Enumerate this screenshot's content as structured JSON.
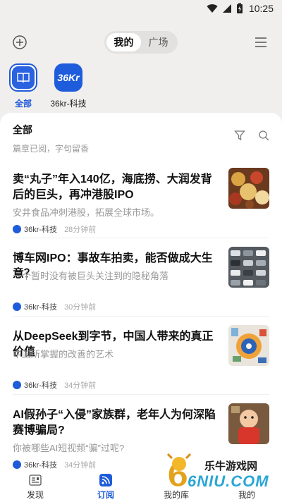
{
  "status_bar": {
    "time": "10:25"
  },
  "top_bar": {
    "add_icon": "plus-circle-icon",
    "segments": [
      {
        "label": "我的",
        "active": true
      },
      {
        "label": "广场",
        "active": false
      }
    ],
    "menu_icon": "hamburger-menu-icon"
  },
  "subscriptions": [
    {
      "label": "全部",
      "icon": "book-icon",
      "active": true
    },
    {
      "label": "36kr-科技",
      "icon": "36kr-logo-icon",
      "logo_text": "36Kr",
      "active": false
    }
  ],
  "list_header": {
    "title": "全部",
    "subtitle": "篇章已阅，字句留香",
    "tools": [
      "filter-icon",
      "search-icon"
    ]
  },
  "articles": [
    {
      "title": "卖“丸子”年入140亿，海底捞、大润发背后的巨头，再冲港股IPO",
      "summary": "安井食品冲刺港股，拓展全球市场。",
      "source": "36kr-科技",
      "time": "28分钟前"
    },
    {
      "title": "博车网IPO：事故车拍卖，能否做成大生意？",
      "summary": "一个暂时没有被巨头关注到的隐秘角落",
      "source": "36kr-科技",
      "time": "30分钟前"
    },
    {
      "title": "从DeepSeek到字节，中国人带来的真正价值",
      "summary": "中国所掌握的改善的艺术",
      "source": "36kr-科技",
      "time": "34分钟前"
    },
    {
      "title": "AI假孙子“入侵”家族群，老年人为何深陷赛博骗局?",
      "summary": "你被哪些AI短视频“骗”过呢?",
      "source": "36kr-科技",
      "time": "34分钟前"
    }
  ],
  "tabbar": [
    {
      "label": "发现",
      "icon": "discover-icon",
      "active": false
    },
    {
      "label": "订阅",
      "icon": "rss-icon",
      "active": true
    },
    {
      "label": "我的库",
      "icon": "library-icon",
      "active": false
    },
    {
      "label": "我的",
      "icon": "profile-icon",
      "active": false
    }
  ],
  "watermark": {
    "text": "乐牛游戏网",
    "logo_text": "6NIU.COM"
  },
  "colors": {
    "accent": "#1e5cdb",
    "background": "#f0efee"
  }
}
